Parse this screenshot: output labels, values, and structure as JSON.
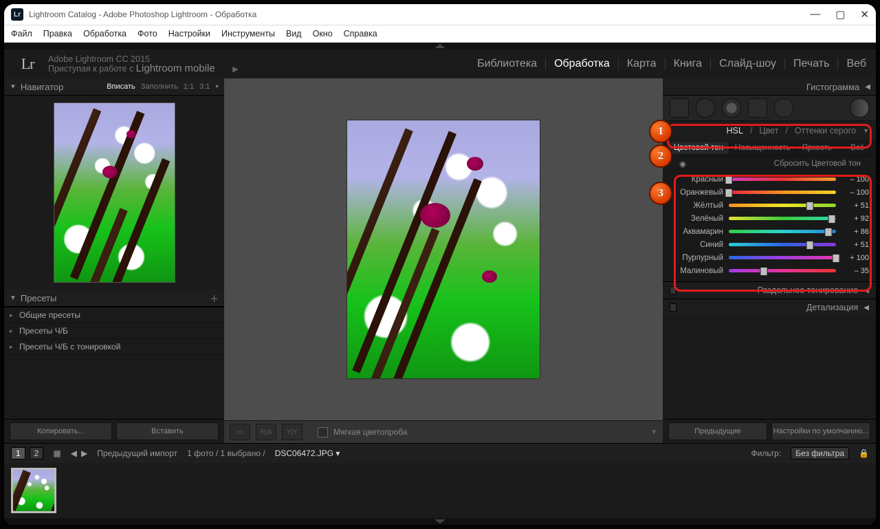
{
  "window": {
    "title": "Lightroom Catalog - Adobe Photoshop Lightroom - Обработка"
  },
  "menu": {
    "items": [
      "Файл",
      "Правка",
      "Обработка",
      "Фото",
      "Настройки",
      "Инструменты",
      "Вид",
      "Окно",
      "Справка"
    ]
  },
  "brand": {
    "cc": "Adobe Lightroom CC 2015",
    "mobile_prefix": "Приступая к работе с ",
    "mobile": "Lightroom mobile"
  },
  "modules": [
    "Библиотека",
    "Обработка",
    "Карта",
    "Книга",
    "Слайд-шоу",
    "Печать",
    "Веб"
  ],
  "modules_active": 1,
  "left": {
    "navigator": "Навигатор",
    "zoom": [
      {
        "l": "Вписать",
        "a": true
      },
      {
        "l": "Заполнить",
        "a": false
      },
      {
        "l": "1:1",
        "a": false
      },
      {
        "l": "3:1",
        "a": false
      }
    ],
    "presets_header": "Пресеты",
    "presets": [
      "Общие пресеты",
      "Пресеты Ч/Б",
      "Пресеты Ч/Б с тонировкой"
    ],
    "copy": "Копировать...",
    "paste": "Вставить"
  },
  "center": {
    "softproof": "Мягкая цветопроба"
  },
  "right": {
    "histogram": "Гистограмма",
    "hsl": {
      "hsl": "HSL",
      "color": "Цвет",
      "gray": "Оттенки серого"
    },
    "subtabs": {
      "hue": "Цветовой тон",
      "sat": "Насыщенность",
      "lum": "Яркость",
      "all": "Всё"
    },
    "reset": "Сбросить Цветовой тон",
    "sliders": [
      {
        "name": "Красный",
        "value": -100,
        "grad": "linear-gradient(90deg,#d139c2,#e33,#f59b2b)"
      },
      {
        "name": "Оранжевый",
        "value": -100,
        "grad": "linear-gradient(90deg,#e24,#f59020,#f2d324)"
      },
      {
        "name": "Жёлтый",
        "value": 51,
        "grad": "linear-gradient(90deg,#f59020,#efe526,#8bd82e)"
      },
      {
        "name": "Зелёный",
        "value": 92,
        "grad": "linear-gradient(90deg,#e6e232,#3bcf3b,#2bd8b0)"
      },
      {
        "name": "Аквамарин",
        "value": 86,
        "grad": "linear-gradient(90deg,#36cf42,#29d3cf,#2b7fe6)"
      },
      {
        "name": "Синий",
        "value": 51,
        "grad": "linear-gradient(90deg,#29cfd2,#2b67e6,#8a36e0)"
      },
      {
        "name": "Пурпурный",
        "value": 100,
        "grad": "linear-gradient(90deg,#2b67e6,#a33be0,#e238b0)"
      },
      {
        "name": "Малиновый",
        "value": -35,
        "grad": "linear-gradient(90deg,#a33be0,#e2349a,#e33)"
      }
    ],
    "split": "Раздельное тонирование",
    "detail": "Детализация",
    "prev": "Предыдущие",
    "defaults": "Настройки по умолчанию..."
  },
  "status": {
    "prev_import": "Предыдущий импорт",
    "count": "1 фото  /  1 выбрано  /",
    "file": "DSC06472.JPG",
    "filter_label": "Фильтр:",
    "filter_value": "Без фильтра"
  },
  "callouts": [
    "1",
    "2",
    "3"
  ]
}
